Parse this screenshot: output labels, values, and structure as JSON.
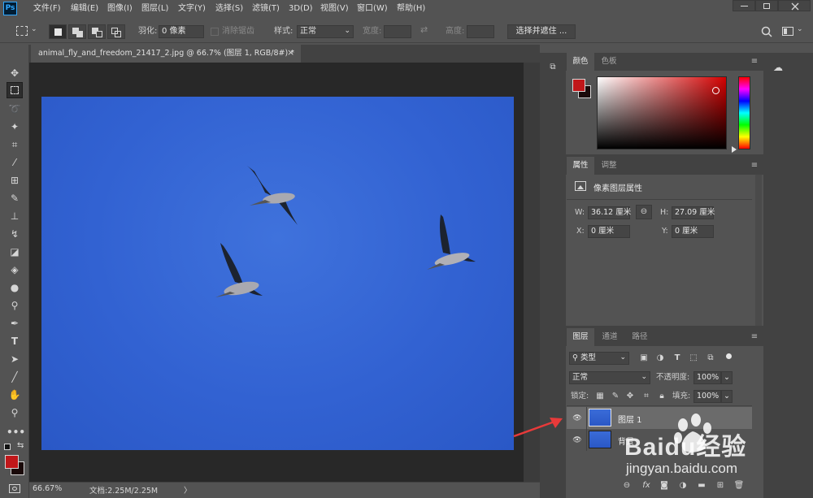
{
  "app": {
    "logo_text": "Ps"
  },
  "menu": [
    "文件(F)",
    "编辑(E)",
    "图像(I)",
    "图层(L)",
    "文字(Y)",
    "选择(S)",
    "滤镜(T)",
    "3D(D)",
    "视图(V)",
    "窗口(W)",
    "帮助(H)"
  ],
  "window_controls": {
    "minimize": "minimize-icon",
    "maximize": "maximize-icon",
    "close": "close-icon"
  },
  "options_bar": {
    "feather_label": "羽化:",
    "feather_value": "0 像素",
    "antialias_label": "消除锯齿",
    "style_label": "样式:",
    "style_value": "正常",
    "width_label": "宽度:",
    "height_label": "高度:",
    "select_mask_button": "选择并遮住 ..."
  },
  "document": {
    "tab_title": "animal_fly_and_freedom_21417_2.jpg @ 66.7% (图层 1, RGB/8#) *",
    "tab_close": "×"
  },
  "status_bar": {
    "zoom": "66.67%",
    "doc_info": "文档:2.25M/2.25M",
    "arrow": "〉"
  },
  "color_panel": {
    "tabs": [
      "颜色",
      "色板"
    ],
    "foreground": "#c0171a",
    "background": "#1a0a0a",
    "hue_color": "#d40000"
  },
  "properties_panel": {
    "tabs": [
      "属性",
      "调整"
    ],
    "title": "像素图层属性",
    "w_label": "W:",
    "w_value": "36.12 厘米",
    "h_label": "H:",
    "h_value": "27.09 厘米",
    "x_label": "X:",
    "x_value": "0 厘米",
    "y_label": "Y:",
    "y_value": "0 厘米"
  },
  "layers_panel": {
    "tabs": [
      "图层",
      "通道",
      "路径"
    ],
    "filter_kind": "类型",
    "blend_mode": "正常",
    "opacity_label": "不透明度:",
    "opacity_value": "100%",
    "lock_label": "锁定:",
    "fill_label": "填充:",
    "fill_value": "100%",
    "layers": [
      {
        "name": "图层 1",
        "selected": true
      },
      {
        "name": "背景",
        "selected": false
      }
    ]
  },
  "watermark": {
    "brand": "Baidu经验",
    "url": "jingyan.baidu.com"
  },
  "annotation_arrow_color": "#e83a3a"
}
